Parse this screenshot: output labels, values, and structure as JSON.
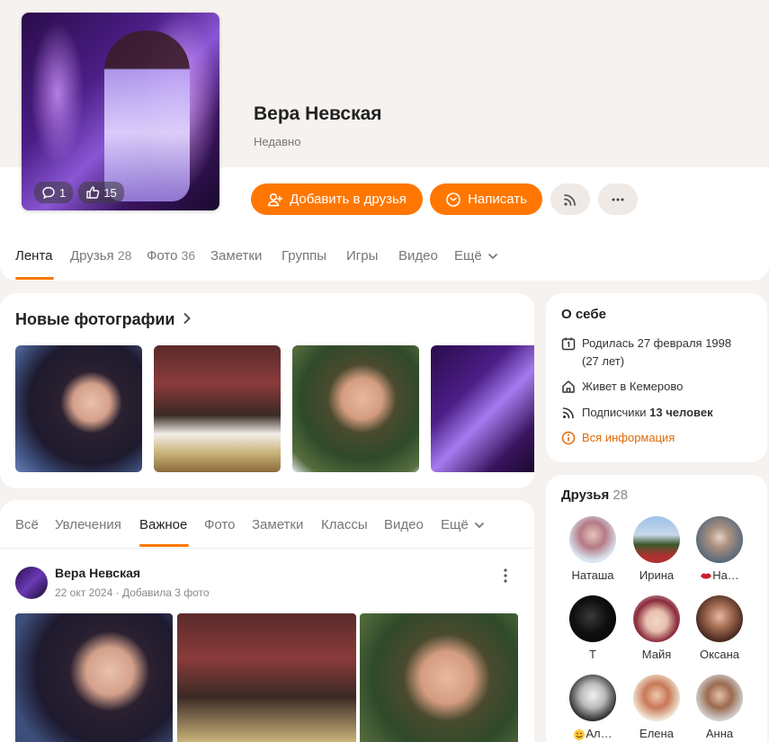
{
  "profile": {
    "name": "Вера Невская",
    "status": "Недавно",
    "comments_count": "1",
    "likes_count": "15"
  },
  "actions": {
    "add_friend": "Добавить в друзья",
    "write": "Написать"
  },
  "tabs": [
    {
      "label": "Лента",
      "count": ""
    },
    {
      "label": "Друзья",
      "count": "28"
    },
    {
      "label": "Фото",
      "count": "36"
    },
    {
      "label": "Заметки",
      "count": ""
    },
    {
      "label": "Группы",
      "count": ""
    },
    {
      "label": "Игры",
      "count": ""
    },
    {
      "label": "Видео",
      "count": ""
    },
    {
      "label": "Ещё",
      "count": ""
    }
  ],
  "new_photos": {
    "title": "Новые фотографии"
  },
  "about": {
    "title": "О себе",
    "born": "Родилась 27 февраля 1998",
    "age": "(27 лет)",
    "lives": "Живет в Кемерово",
    "followers_prefix": "Подписчики",
    "followers_value": "13 человек",
    "all_info": "Вся информация"
  },
  "feed_tabs": [
    {
      "label": "Всё"
    },
    {
      "label": "Увлечения"
    },
    {
      "label": "Важное"
    },
    {
      "label": "Фото"
    },
    {
      "label": "Заметки"
    },
    {
      "label": "Классы"
    },
    {
      "label": "Видео"
    },
    {
      "label": "Ещё"
    }
  ],
  "post": {
    "author": "Вера Невская",
    "date": "22 окт 2024",
    "separator": "·",
    "action": "Добавила 3 фото"
  },
  "friends": {
    "title": "Друзья",
    "count": "28",
    "list": [
      {
        "name": "Наташа"
      },
      {
        "name": "Ирина"
      },
      {
        "name": "На…"
      },
      {
        "name": "Т"
      },
      {
        "name": "Майя"
      },
      {
        "name": "Оксана"
      },
      {
        "name": "Ал…"
      },
      {
        "name": "Елена"
      },
      {
        "name": "Анна"
      }
    ]
  },
  "colors": {
    "accent": "#ff7700",
    "background": "#f6f2ef"
  }
}
